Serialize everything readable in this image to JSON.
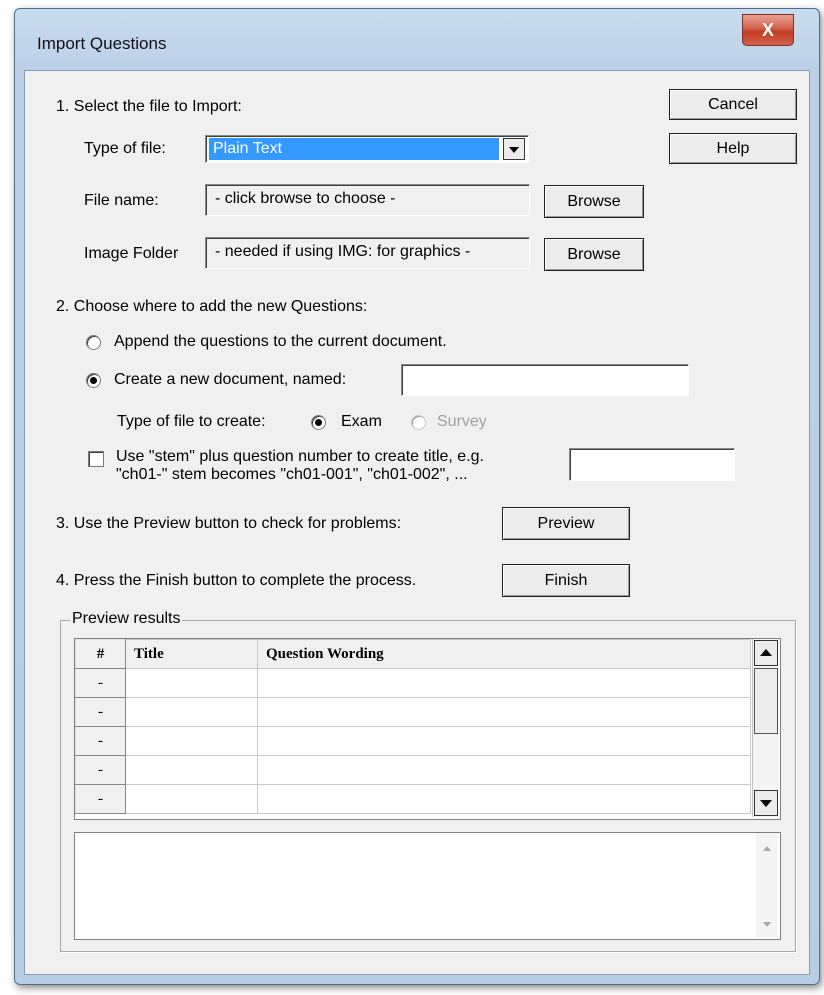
{
  "window": {
    "title": "Import Questions",
    "close_glyph": "X"
  },
  "buttons": {
    "cancel": "Cancel",
    "help": "Help",
    "browse_file": "Browse",
    "browse_image": "Browse",
    "preview": "Preview",
    "finish": "Finish"
  },
  "step1": {
    "heading": "1.  Select the file to Import:",
    "type_label": "Type of file:",
    "type_value": "Plain Text",
    "file_label": "File name:",
    "file_value": "- click browse to choose -",
    "image_label": "Image Folder",
    "image_value": "- needed if using IMG: for graphics -"
  },
  "step2": {
    "heading": "2.  Choose where to add the new Questions:",
    "append_label": "Append the questions to the current document.",
    "create_label": "Create a new document, named:",
    "create_value": "",
    "type_create_label": "Type of file to create:",
    "exam_label": "Exam",
    "survey_label": "Survey",
    "stem_line1": "Use \"stem\" plus question number to create title,  e.g.",
    "stem_line2": "\"ch01-\" stem becomes \"ch01-001\",  \"ch01-002\",  ...",
    "stem_value": ""
  },
  "step3": {
    "heading": "3.  Use the Preview button to check for problems:"
  },
  "step4": {
    "heading": "4.  Press the Finish button to complete the process."
  },
  "preview": {
    "group_label": "Preview results",
    "columns": [
      "#",
      "Title",
      "Question Wording"
    ],
    "rows": [
      {
        "num": "-",
        "title": "",
        "wording": ""
      },
      {
        "num": "-",
        "title": "",
        "wording": ""
      },
      {
        "num": "-",
        "title": "",
        "wording": ""
      },
      {
        "num": "-",
        "title": "",
        "wording": ""
      },
      {
        "num": "-",
        "title": "",
        "wording": ""
      }
    ]
  },
  "icons": {
    "dropdown": "dropdown-arrow-icon",
    "scroll_up": "scroll-up-icon",
    "scroll_down": "scroll-down-icon"
  },
  "colors": {
    "selected_highlight": "#3399ff",
    "title_bar": "#bcd1e8",
    "close_button": "#c23d22"
  },
  "states": {
    "append_selected": false,
    "create_selected": true,
    "exam_selected": true,
    "survey_enabled": false,
    "stem_checked": false
  }
}
